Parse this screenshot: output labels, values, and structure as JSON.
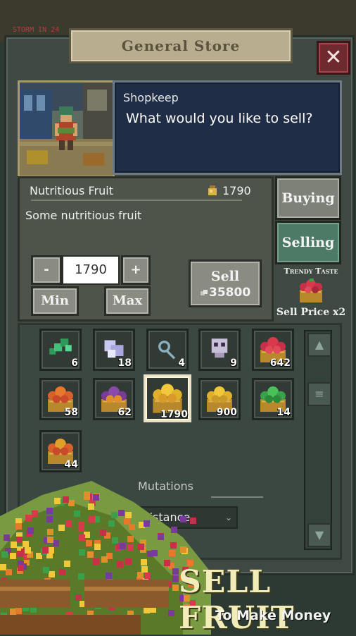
{
  "background": {
    "storm_label": "STORM IN 24"
  },
  "store": {
    "title": "General Store",
    "close_label": "✕"
  },
  "dialog": {
    "speaker": "Shopkeep",
    "message": "What would you like to sell?"
  },
  "item": {
    "name": "Nutritious Fruit",
    "owned": "1790",
    "description": "Some nutritious fruit"
  },
  "quantity": {
    "decrease": "-",
    "increase": "+",
    "value": "1790",
    "min": "Min",
    "max": "Max"
  },
  "sell": {
    "label": "Sell",
    "price": "35800"
  },
  "tabs": {
    "buying": "Buying",
    "selling": "Selling"
  },
  "bonus": {
    "title": "Trendy Taste",
    "text": "Sell Price x2"
  },
  "inventory": [
    {
      "count": "6",
      "icon": "green-leaf-icon"
    },
    {
      "count": "18",
      "icon": "crystal-icon"
    },
    {
      "count": "4",
      "icon": "key-icon"
    },
    {
      "count": "9",
      "icon": "skull-icon"
    },
    {
      "count": "642",
      "icon": "red-fruit-basket-icon"
    },
    {
      "count": "58",
      "icon": "orange-fruit-basket-icon"
    },
    {
      "count": "62",
      "icon": "purple-fruit-basket-icon"
    },
    {
      "count": "1790",
      "icon": "nutritious-fruit-basket-icon"
    },
    {
      "count": "900",
      "icon": "yellow-fruit-basket-icon"
    },
    {
      "count": "14",
      "icon": "green-fruit-basket-icon"
    },
    {
      "count": "44",
      "icon": "mixed-fruit-basket-icon"
    }
  ],
  "mutations": {
    "label": "Mutations",
    "selected": "Resistance"
  },
  "promo": {
    "title": "SELL FRUIT",
    "subtitle": "To Make Money"
  },
  "colors": {
    "gold": "#d9b24a",
    "selected_tab": "#4c7a66",
    "panel": "#3f4943",
    "promo_text": "#f2edb8"
  }
}
